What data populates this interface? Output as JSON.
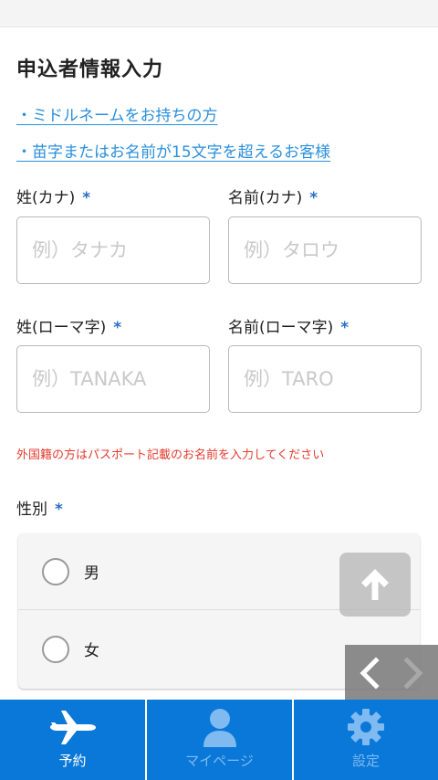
{
  "page": {
    "title": "申込者情報入力",
    "links": [
      "・ミドルネームをお持ちの方",
      "・苗字またはお名前が15文字を超えるお客様"
    ]
  },
  "form": {
    "required_mark": "*",
    "last_name_kana": {
      "label": "姓(カナ)",
      "placeholder": "例）タナカ",
      "value": ""
    },
    "first_name_kana": {
      "label": "名前(カナ)",
      "placeholder": "例）タロウ",
      "value": ""
    },
    "last_name_roman": {
      "label": "姓(ローマ字)",
      "placeholder": "例）TANAKA",
      "value": ""
    },
    "first_name_roman": {
      "label": "名前(ローマ字)",
      "placeholder": "例）TARO",
      "value": ""
    },
    "notice": "外国籍の方はパスポート記載のお名前を入力してください",
    "gender": {
      "label": "性別",
      "options": [
        "男",
        "女"
      ],
      "selected": null
    }
  },
  "tabbar": {
    "tabs": [
      {
        "label": "予約",
        "icon": "airplane-icon",
        "active": true
      },
      {
        "label": "マイページ",
        "icon": "user-icon",
        "active": false
      },
      {
        "label": "設定",
        "icon": "gear-icon",
        "active": false
      }
    ]
  },
  "colors": {
    "accent": "#0a78d8",
    "link": "#2a8fdc",
    "required": "#2a6fc4",
    "warning": "#e63a2e",
    "inactive_tab": "#7fbaf0"
  }
}
